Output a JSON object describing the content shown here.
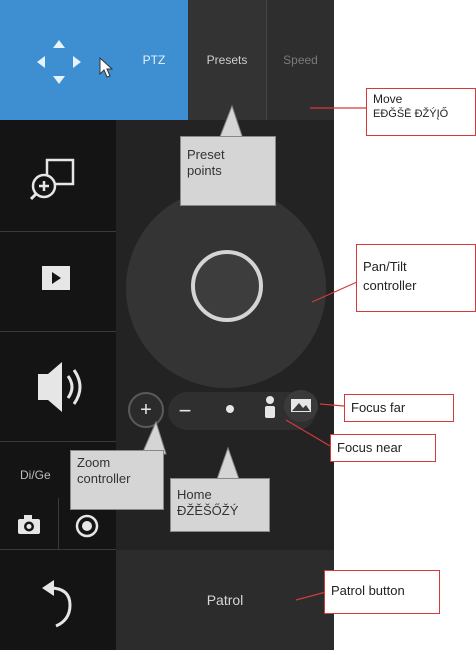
{
  "tabs": {
    "ptz": "PTZ",
    "presets": "Presets",
    "speed": "Speed"
  },
  "sidebar": {
    "digital_label": "Di/Ge",
    "patrol_label": "Patrol"
  },
  "callouts": {
    "move": [
      "Move",
      "EÐĞŠĒ ĐŽÝĮŐ"
    ],
    "preset_points": [
      "Preset",
      "points"
    ],
    "pan_tilt": [
      "Pan/Tilt",
      "controller"
    ],
    "focus_far": "Focus far",
    "focus_near": "Focus near",
    "zoom": [
      "Zoom",
      "controller"
    ],
    "home": [
      "Home",
      "ĐŽĚŠŐŽÝ"
    ],
    "patrol_button": "Patrol button"
  },
  "colors": {
    "accent": "#3d8fd1",
    "panel": "#1f1f1f",
    "callout_border": "#d43a3a"
  },
  "icons": {
    "move": "arrows-move-icon",
    "digital_ptz": "zoom-window-icon",
    "play": "play-icon",
    "volume": "speaker-icon",
    "snapshot": "camera-icon",
    "record": "record-icon",
    "back": "undo-arrow-icon",
    "home": "dot-icon",
    "focus_near": "person-icon",
    "focus_far": "landscape-icon"
  }
}
